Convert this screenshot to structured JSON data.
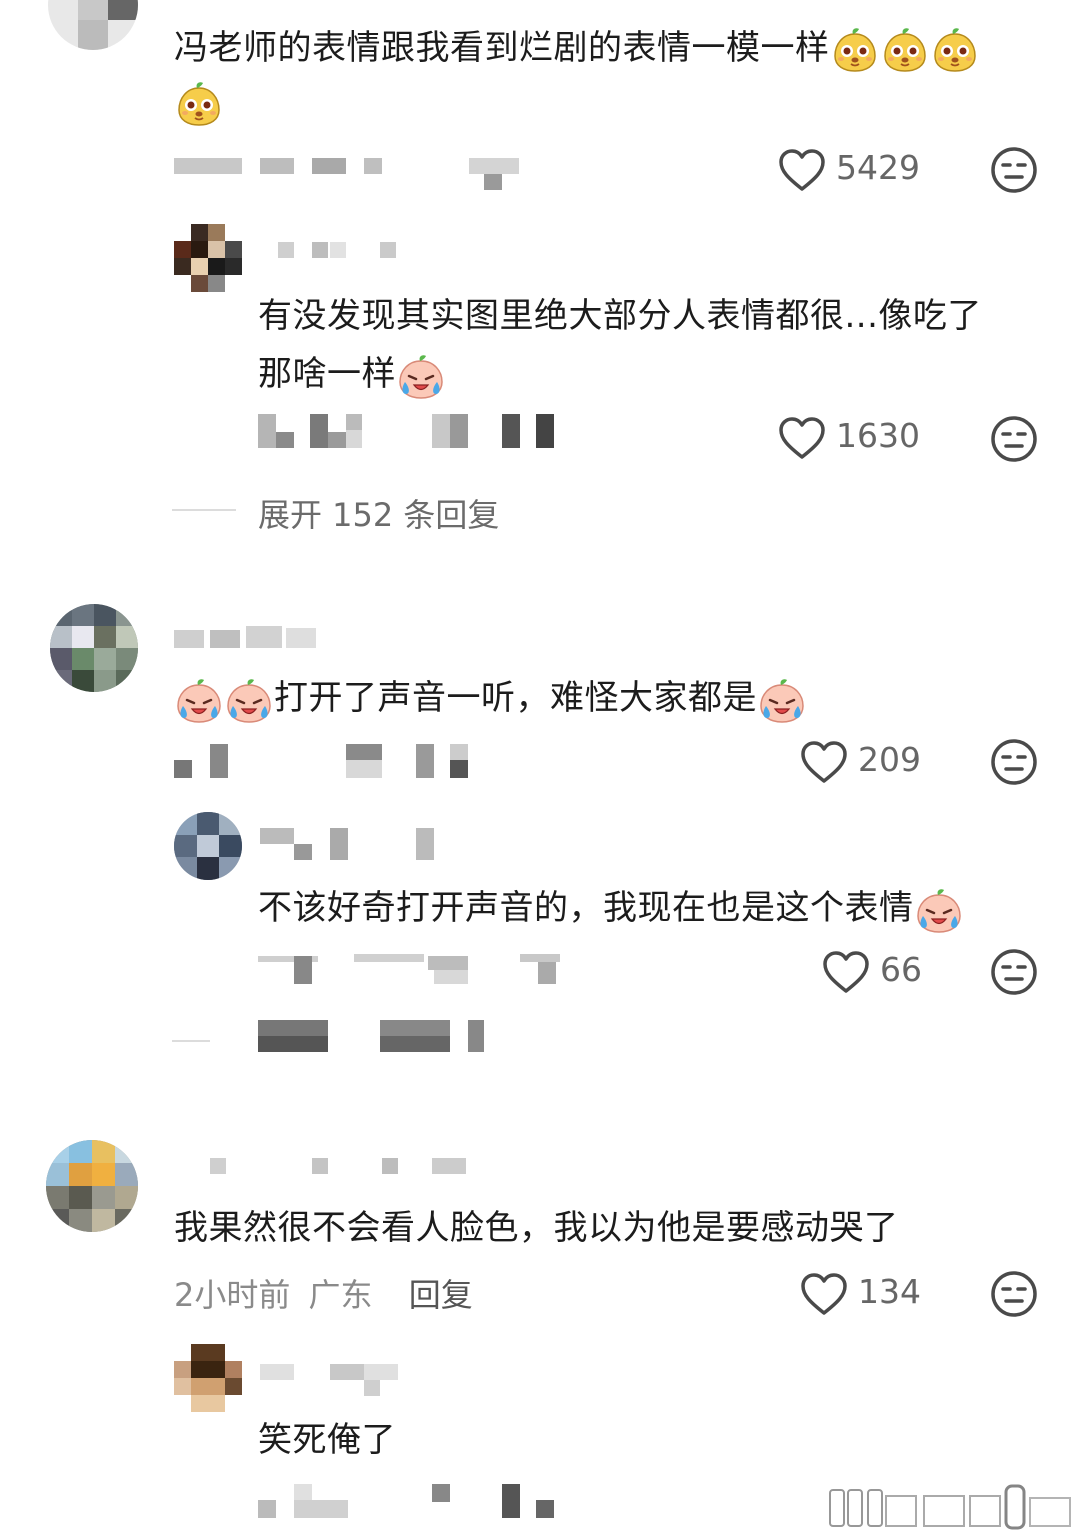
{
  "comments": [
    {
      "text": "冯老师的表情跟我看到烂剧的表情一模一样",
      "emoji": "mango-emoji",
      "likes": "5429",
      "replies": [
        {
          "text_line1": "有没发现其实图里绝大部分人表情都很...像吃了",
          "text_line2": "那啥一样",
          "emoji": "crying-peach-emoji",
          "likes": "1630"
        }
      ],
      "expand_label": "展开 152 条回复"
    },
    {
      "text": "打开了声音一听，难怪大家都是",
      "emoji": "crying-peach-emoji",
      "likes": "209",
      "replies": [
        {
          "text": "不该好奇打开声音的，我现在也是这个表情",
          "emoji": "crying-peach-emoji",
          "likes": "66"
        }
      ]
    },
    {
      "text": "我果然很不会看人脸色，我以为他是要感动哭了",
      "meta_time": "2小时前",
      "meta_location": "广东",
      "reply_label": "回复",
      "likes": "134",
      "replies": [
        {
          "text": "笑死俺了"
        }
      ]
    }
  ],
  "icons": {
    "like": "heart-outline-icon",
    "dislike": "neutral-face-icon"
  },
  "colors": {
    "text": "#1c1c1c",
    "meta": "#8a8a8a",
    "icon": "#4a4a4a",
    "mosaic_dark": "#555555",
    "mosaic_light": "#d6d6d6"
  }
}
